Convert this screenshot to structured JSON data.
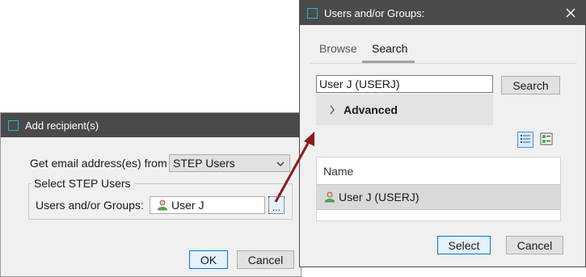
{
  "add_recipient": {
    "title": "Add recipient(s)",
    "email_from_label": "Get email address(es) from",
    "email_from_value": "STEP Users",
    "group_legend": "Select STEP Users",
    "users_groups_label": "Users and/or Groups:",
    "selected_user": "User J",
    "browse_button": "...",
    "ok_label": "OK",
    "cancel_label": "Cancel"
  },
  "users_groups_dialog": {
    "title": "Users and/or Groups:",
    "tabs": [
      {
        "label": "Browse",
        "active": false
      },
      {
        "label": "Search",
        "active": true
      }
    ],
    "search_value": "User J (USERJ)",
    "search_button": "Search",
    "advanced_label": "Advanced",
    "table": {
      "column_header": "Name",
      "rows": [
        {
          "name": "User J (USERJ)",
          "selected": true
        }
      ]
    },
    "select_label": "Select",
    "cancel_label": "Cancel"
  },
  "colors": {
    "titlebar": "#4a4a4a",
    "title_icon": "#2fb3cf",
    "accent": "#0078d7",
    "arrow": "#8b1c1c",
    "selected_row": "#d9d9d9"
  },
  "icons": {
    "title_icon": "window-square-icon",
    "user_icon": "user-icon",
    "close_icon": "close-icon",
    "list_view_icon": "list-view-icon",
    "detail_view_icon": "detail-view-icon",
    "expand_icon": "chevron-right-icon",
    "dropdown_icon": "chevron-down-icon"
  }
}
